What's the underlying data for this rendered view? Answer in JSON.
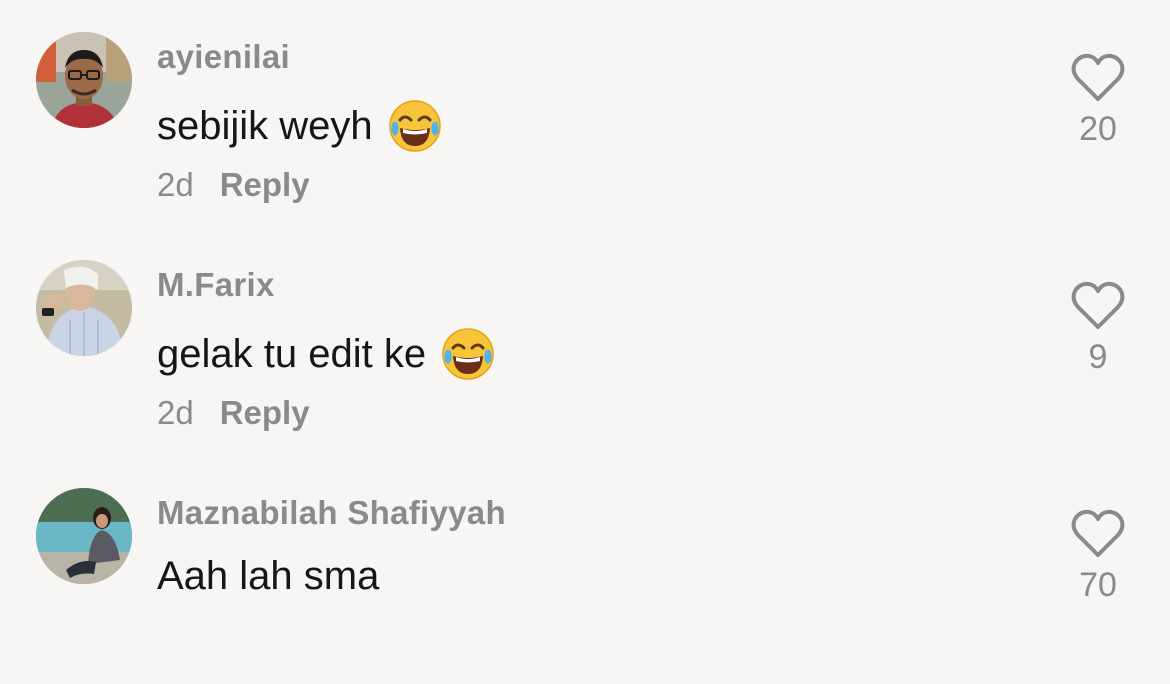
{
  "comments": [
    {
      "username": "ayienilai",
      "text": "sebijik weyh",
      "emoji": "face-with-tears-of-joy",
      "time": "2d",
      "reply_label": "Reply",
      "likes": "20"
    },
    {
      "username": "M.Farix",
      "text": "gelak tu edit ke",
      "emoji": "face-with-tears-of-joy",
      "time": "2d",
      "reply_label": "Reply",
      "likes": "9"
    },
    {
      "username": "Maznabilah Shafiyyah",
      "text": "Aah lah sma",
      "likes": "70"
    }
  ],
  "icons": {
    "like": "heart-outline-icon"
  },
  "colors": {
    "background": "#f7f6f5",
    "text_primary": "#161616",
    "text_secondary": "#8a8a8a"
  }
}
